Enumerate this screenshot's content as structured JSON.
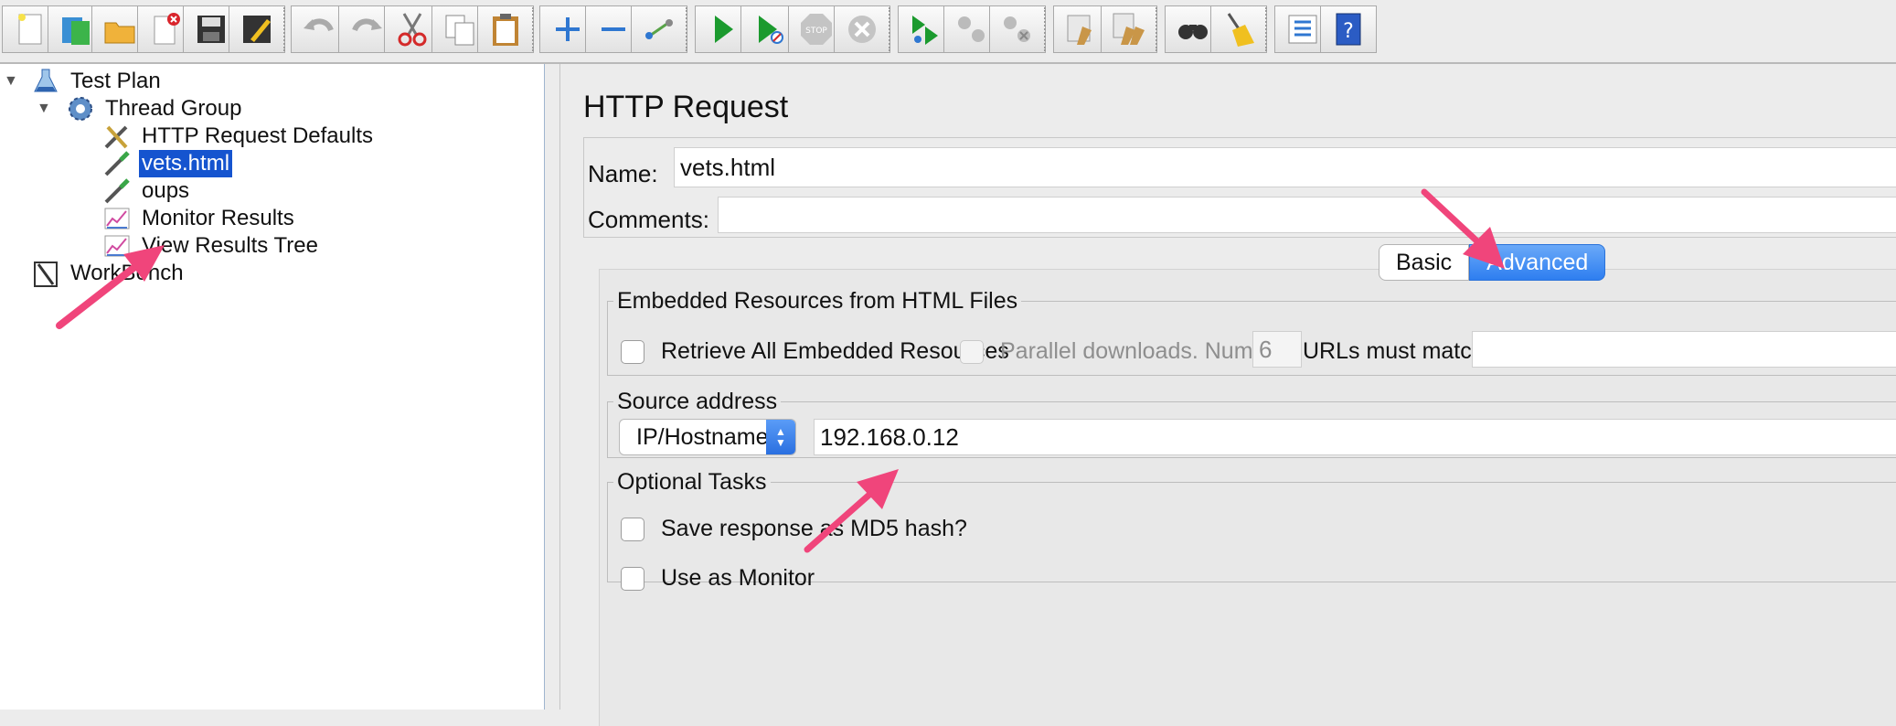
{
  "toolbar": {
    "buttons": [
      {
        "name": "new-icon"
      },
      {
        "name": "templates-icon"
      },
      {
        "name": "open-icon"
      },
      {
        "name": "close-icon"
      },
      {
        "name": "save-icon"
      },
      {
        "name": "save-as-icon"
      },
      {
        "name": "undo-icon"
      },
      {
        "name": "redo-icon"
      },
      {
        "name": "cut-icon"
      },
      {
        "name": "copy-icon"
      },
      {
        "name": "paste-icon"
      },
      {
        "name": "expand-icon"
      },
      {
        "name": "collapse-icon"
      },
      {
        "name": "toggle-icon"
      },
      {
        "name": "start-icon"
      },
      {
        "name": "start-no-pause-icon"
      },
      {
        "name": "stop-icon"
      },
      {
        "name": "shutdown-icon"
      },
      {
        "name": "remote-start-icon"
      },
      {
        "name": "remote-stop-icon"
      },
      {
        "name": "remote-exit-icon"
      },
      {
        "name": "clear-icon"
      },
      {
        "name": "clear-all-icon"
      },
      {
        "name": "search-icon"
      },
      {
        "name": "reset-search-icon"
      },
      {
        "name": "function-helper-icon"
      },
      {
        "name": "help-icon"
      }
    ]
  },
  "tree": {
    "items": [
      {
        "label": "Test Plan",
        "icon": "flask-icon"
      },
      {
        "label": "Thread Group",
        "icon": "gear-icon"
      },
      {
        "label": "HTTP Request Defaults",
        "icon": "tools-icon"
      },
      {
        "label": "vets.html",
        "icon": "pipette-icon",
        "selected": true
      },
      {
        "label": "oups",
        "icon": "pipette-icon"
      },
      {
        "label": "Monitor Results",
        "icon": "graph-icon"
      },
      {
        "label": "View Results Tree",
        "icon": "graph-icon"
      },
      {
        "label": "WorkBench",
        "icon": "workbench-icon"
      }
    ]
  },
  "editor": {
    "title": "HTTP Request",
    "name_label": "Name:",
    "name_value": "vets.html",
    "comments_label": "Comments:",
    "comments_value": "",
    "tabs": [
      {
        "label": "Basic",
        "active": false
      },
      {
        "label": "Advanced",
        "active": true
      }
    ],
    "embedded": {
      "legend": "Embedded Resources from HTML Files",
      "retrieve_label": "Retrieve All Embedded Resources",
      "parallel_label": "Parallel downloads. Number:",
      "parallel_value": "6",
      "urls_label": "URLs must match:",
      "urls_value": ""
    },
    "source": {
      "legend": "Source address",
      "select_value": "IP/Hostname",
      "address_value": "192.168.0.12"
    },
    "optional": {
      "legend": "Optional Tasks",
      "md5_label": "Save response as MD5 hash?",
      "monitor_label": "Use as Monitor"
    }
  },
  "colors": {
    "selection": "#1554cf",
    "tab_active": "#2e7ef0",
    "annotation_arrow": "#f0457b"
  }
}
